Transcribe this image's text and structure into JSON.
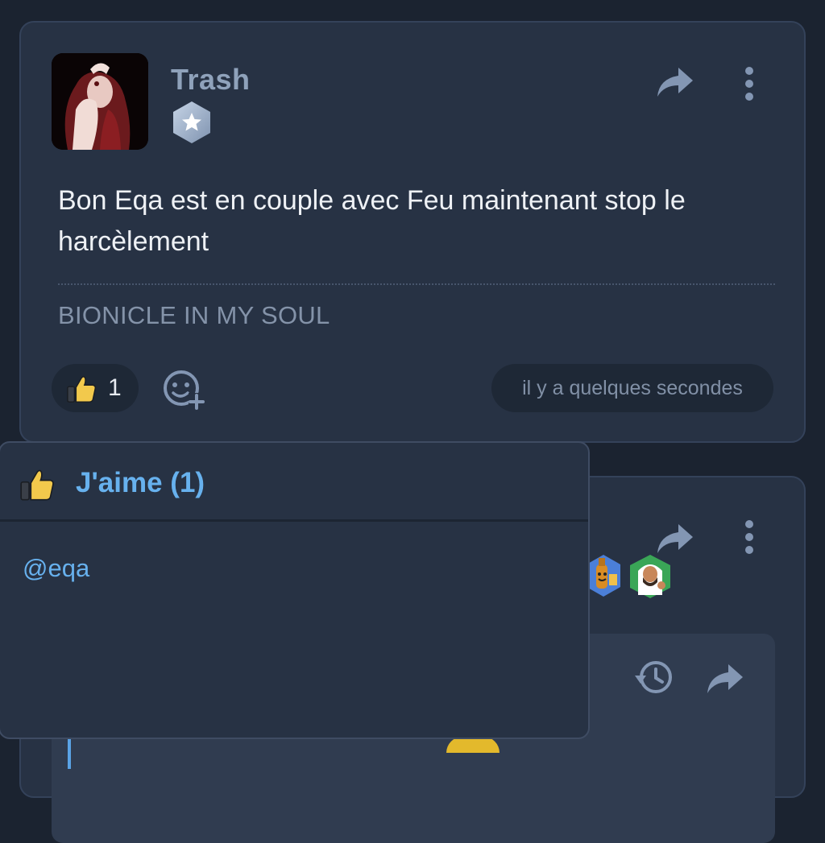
{
  "post": {
    "username": "Trash",
    "content": "Bon Eqa est en couple avec Feu maintenant stop le harcèlement",
    "signature": "BIONICLE IN MY SOUL",
    "reactions": [
      {
        "icon": "thumbs-up-icon",
        "count": "1"
      }
    ],
    "timestamp": "il y a quelques secondes"
  },
  "reaction_popup": {
    "title": "J'aime (1)",
    "users": [
      "@eqa"
    ]
  },
  "colors": {
    "background": "#1b2330",
    "card": "#273244",
    "username": "#8fa2bb",
    "link": "#67b1ee"
  }
}
